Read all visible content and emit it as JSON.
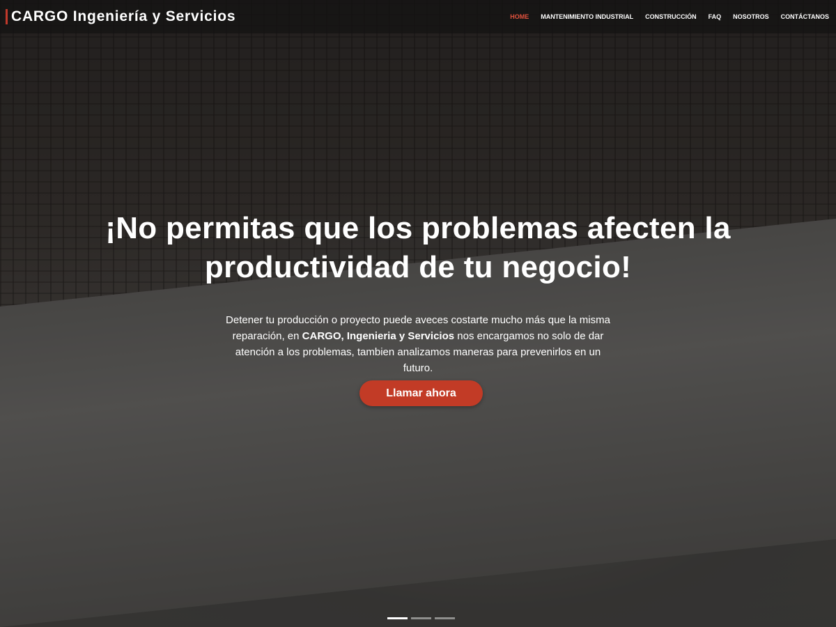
{
  "header": {
    "brand": "CARGO Ingeniería y Servicios"
  },
  "nav": {
    "items": [
      {
        "label": "HOME",
        "active": true
      },
      {
        "label": "MANTENIMIENTO INDUSTRIAL",
        "active": false
      },
      {
        "label": "CONSTRUCCIÓN",
        "active": false
      },
      {
        "label": "FAQ",
        "active": false
      },
      {
        "label": "NOSOTROS",
        "active": false
      },
      {
        "label": "CONTÁCTANOS",
        "active": false
      }
    ]
  },
  "hero": {
    "headline_line1": "¡No permitas que los problemas afecten la",
    "headline_line2": "productividad de tu negocio!",
    "body_part1": "Detener tu producción o proyecto puede aveces costarte mucho más que la misma reparación, en",
    "body_bold": "CARGO, Ingenieria y Servicios",
    "body_part2": "nos encargamos no solo de dar atención a los problemas, tambien analizamos maneras para prevenirlos en un futuro.",
    "cta_label": "Llamar ahora",
    "slide_count": 3,
    "active_slide": 1
  },
  "colors": {
    "accent": "#c23b26",
    "nav_active": "#e2523d",
    "brand_bar": "#c0392b"
  },
  "icons": {
    "background_image": "construction-workers-photo"
  }
}
